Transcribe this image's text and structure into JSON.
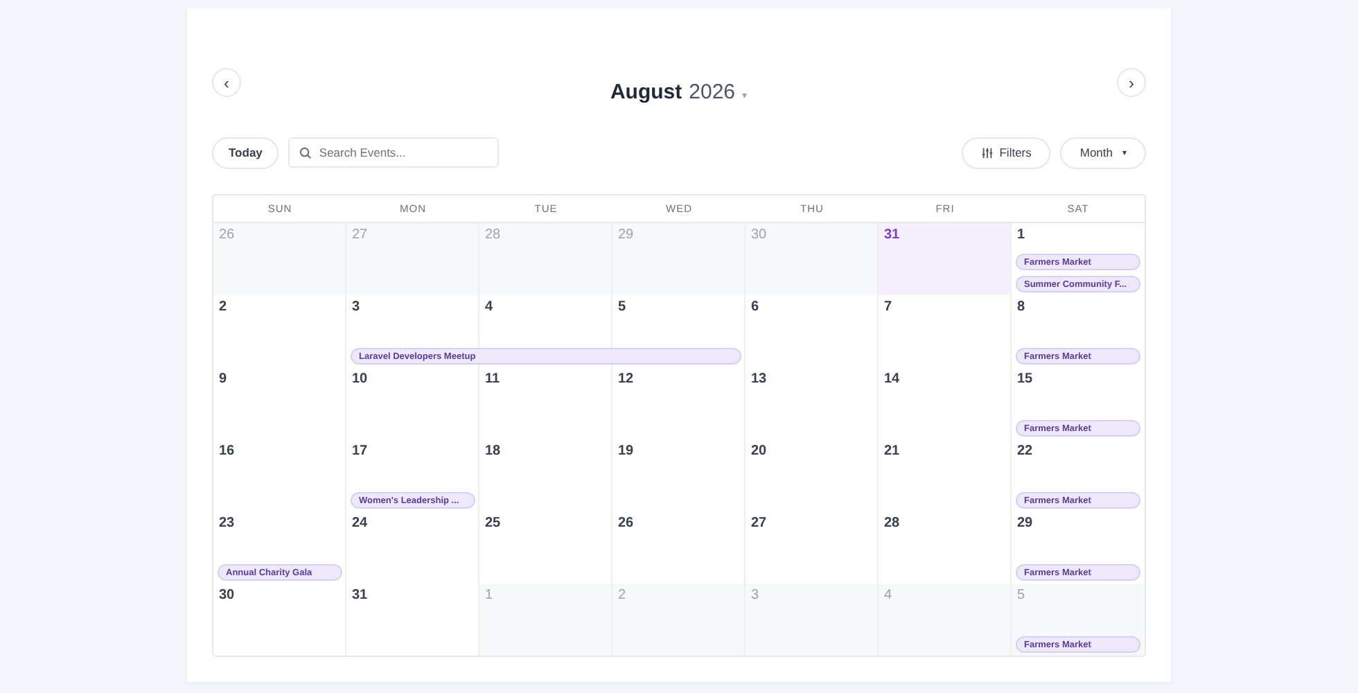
{
  "header": {
    "prev": "‹",
    "next": "›",
    "month": "August",
    "year": "2026",
    "caret": "▾"
  },
  "toolbar": {
    "today": "Today",
    "search": {
      "placeholder": "Search Events..."
    },
    "filters": "Filters",
    "view": "Month",
    "view_caret": "▾"
  },
  "weekdays": [
    "SUN",
    "MON",
    "TUE",
    "WED",
    "THU",
    "FRI",
    "SAT"
  ],
  "weeks": [
    {
      "days": [
        {
          "label": "26",
          "outside": true,
          "today": false
        },
        {
          "label": "27",
          "outside": true,
          "today": false
        },
        {
          "label": "28",
          "outside": true,
          "today": false
        },
        {
          "label": "29",
          "outside": true,
          "today": false
        },
        {
          "label": "30",
          "outside": true,
          "today": false
        },
        {
          "label": "31",
          "outside": true,
          "today": true
        },
        {
          "label": "1",
          "outside": false,
          "today": false,
          "events": [
            {
              "kind": "event",
              "title": "Farmers Market"
            },
            {
              "kind": "event",
              "title": "Summer Community F..."
            }
          ]
        }
      ]
    },
    {
      "days": [
        {
          "label": "2",
          "outside": false,
          "today": false
        },
        {
          "label": "3",
          "outside": false,
          "today": false,
          "events": [
            {
              "kind": "event",
              "title": "Laravel Developers Meetup"
            }
          ]
        },
        {
          "label": "4",
          "outside": false,
          "today": false,
          "events": [
            {
              "kind": "continued"
            }
          ]
        },
        {
          "label": "5",
          "outside": false,
          "today": false,
          "events": [
            {
              "kind": "continued"
            }
          ]
        },
        {
          "label": "6",
          "outside": false,
          "today": false
        },
        {
          "label": "7",
          "outside": false,
          "today": false
        },
        {
          "label": "8",
          "outside": false,
          "today": false,
          "events": [
            {
              "kind": "event",
              "title": "Farmers Market"
            }
          ]
        }
      ]
    },
    {
      "days": [
        {
          "label": "9",
          "outside": false,
          "today": false
        },
        {
          "label": "10",
          "outside": false,
          "today": false
        },
        {
          "label": "11",
          "outside": false,
          "today": false
        },
        {
          "label": "12",
          "outside": false,
          "today": false
        },
        {
          "label": "13",
          "outside": false,
          "today": false
        },
        {
          "label": "14",
          "outside": false,
          "today": false
        },
        {
          "label": "15",
          "outside": false,
          "today": false,
          "events": [
            {
              "kind": "event",
              "title": "Farmers Market"
            }
          ]
        }
      ]
    },
    {
      "days": [
        {
          "label": "16",
          "outside": false,
          "today": false
        },
        {
          "label": "17",
          "outside": false,
          "today": false,
          "events": [
            {
              "kind": "event",
              "title": "Women's Leadership ..."
            }
          ]
        },
        {
          "label": "18",
          "outside": false,
          "today": false
        },
        {
          "label": "19",
          "outside": false,
          "today": false
        },
        {
          "label": "20",
          "outside": false,
          "today": false
        },
        {
          "label": "21",
          "outside": false,
          "today": false
        },
        {
          "label": "22",
          "outside": false,
          "today": false,
          "events": [
            {
              "kind": "event",
              "title": "Farmers Market"
            }
          ]
        }
      ]
    },
    {
      "days": [
        {
          "label": "23",
          "outside": false,
          "today": false,
          "events": [
            {
              "kind": "event",
              "title": "Annual Charity Gala"
            }
          ]
        },
        {
          "label": "24",
          "outside": false,
          "today": false
        },
        {
          "label": "25",
          "outside": false,
          "today": false
        },
        {
          "label": "26",
          "outside": false,
          "today": false
        },
        {
          "label": "27",
          "outside": false,
          "today": false
        },
        {
          "label": "28",
          "outside": false,
          "today": false
        },
        {
          "label": "29",
          "outside": false,
          "today": false,
          "events": [
            {
              "kind": "event",
              "title": "Farmers Market"
            }
          ]
        }
      ]
    },
    {
      "days": [
        {
          "label": "30",
          "outside": false,
          "today": false
        },
        {
          "label": "31",
          "outside": false,
          "today": false
        },
        {
          "label": "1",
          "outside": true,
          "today": false
        },
        {
          "label": "2",
          "outside": true,
          "today": false
        },
        {
          "label": "3",
          "outside": true,
          "today": false
        },
        {
          "label": "4",
          "outside": true,
          "today": false
        },
        {
          "label": "5",
          "outside": true,
          "today": false,
          "events": [
            {
              "kind": "event",
              "title": "Farmers Market"
            }
          ]
        }
      ]
    }
  ]
}
